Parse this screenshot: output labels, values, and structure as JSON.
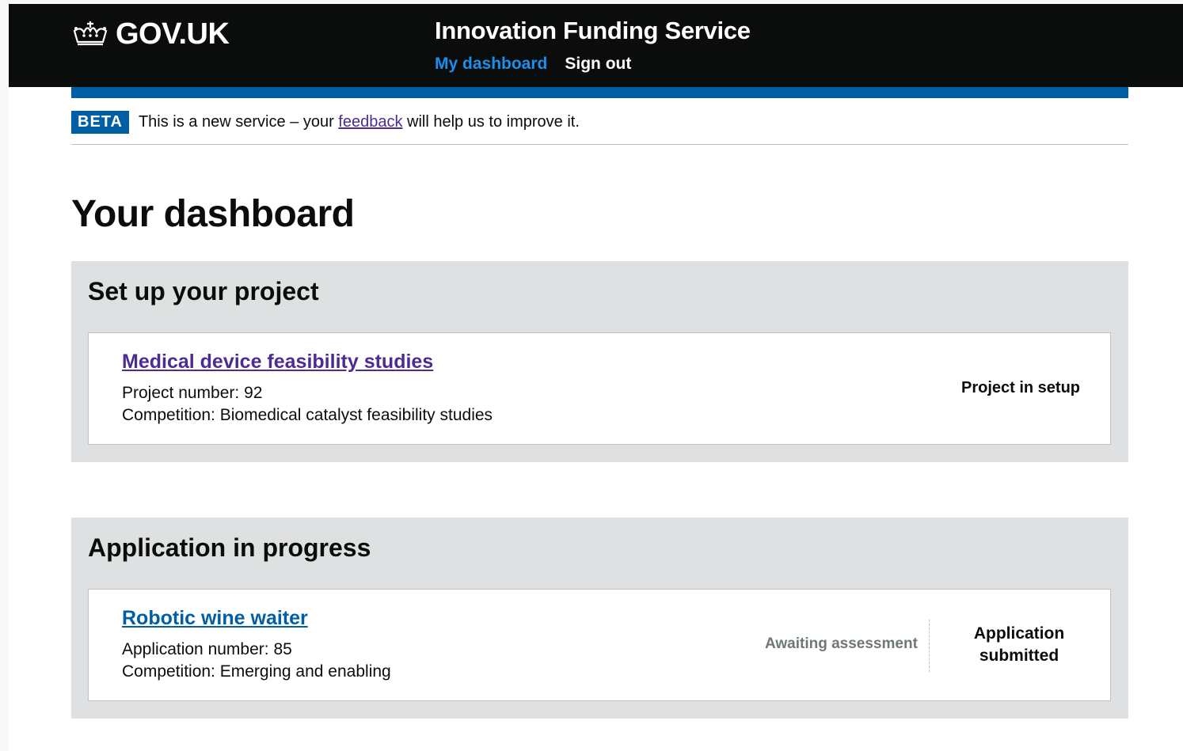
{
  "header": {
    "logo_text": "GOV.UK",
    "logo_icon": "crown-icon",
    "service_name": "Innovation Funding Service",
    "nav": {
      "dashboard_label": "My dashboard",
      "signout_label": "Sign out"
    }
  },
  "beta_banner": {
    "tag": "BETA",
    "text_before": "This is a new service – your",
    "link": "feedback",
    "text_after": "will help us to improve it."
  },
  "page_title": "Your dashboard",
  "setup_section": {
    "heading": "Set up your project",
    "project": {
      "title": "Medical device feasibility studies",
      "number_line": "Project number: 92",
      "competition_line": "Competition: Biomedical catalyst feasibility studies",
      "status": "Project in setup"
    }
  },
  "applications_section": {
    "heading": "Application in progress",
    "application": {
      "title": "Robotic wine waiter",
      "number_line": "Application number: 85",
      "competition_line": "Competition: Emerging and enabling",
      "assessment_status": "Awaiting assessment",
      "status_line1": "Application",
      "status_line2": "submitted"
    }
  },
  "colors": {
    "header_bg": "#0b0c0c",
    "brand_blue": "#005ea5",
    "visited_link": "#4c2c92",
    "panel_bg": "#dee0e2",
    "nav_active": "#1d8feb"
  }
}
